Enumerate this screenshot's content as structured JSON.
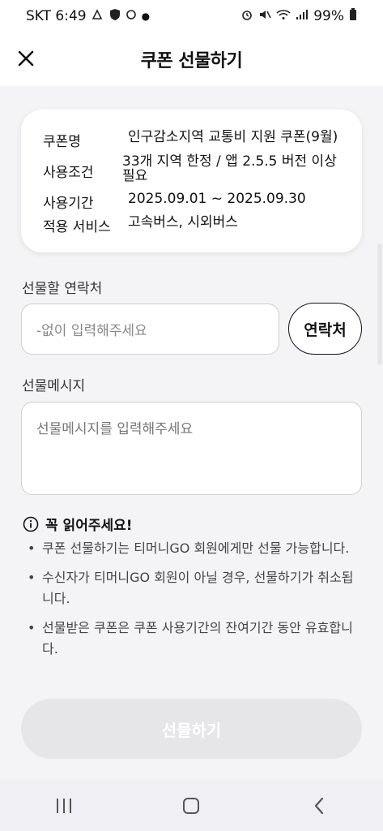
{
  "status_bar": {
    "carrier_time": "SKT 6:49",
    "battery": "99%"
  },
  "header": {
    "title": "쿠폰 선물하기"
  },
  "coupon": {
    "rows": [
      {
        "label": "쿠폰명",
        "value": "인구감소지역 교통비 지원 쿠폰(9월)"
      },
      {
        "label": "사용조건",
        "value": "33개 지역 한정 / 앱 2.5.5 버전 이상 필요"
      },
      {
        "label": "사용기간",
        "value": "2025.09.01 ~ 2025.09.30"
      },
      {
        "label": "적용 서비스",
        "value": "고속버스, 시외버스"
      }
    ]
  },
  "contact": {
    "label": "선물할 연락처",
    "placeholder": "-없이 입력해주세요",
    "button_label": "연락처"
  },
  "message": {
    "label": "선물메시지",
    "placeholder": "선물메시지를 입력해주세요"
  },
  "notice": {
    "title": "꼭 읽어주세요!",
    "items": [
      "쿠폰 선물하기는 티머니GO 회원에게만 선물 가능합니다.",
      "수신자가 티머니GO 회원이 아닐 경우, 선물하기가 취소됩니다.",
      "선물받은 쿠폰은 쿠폰 사용기간의 잔여기간 동안 유효합니다."
    ]
  },
  "gift_button": {
    "label": "선물하기"
  },
  "colors": {
    "background": "#f4f4f6",
    "disabled_button": "#e6e6e8"
  }
}
